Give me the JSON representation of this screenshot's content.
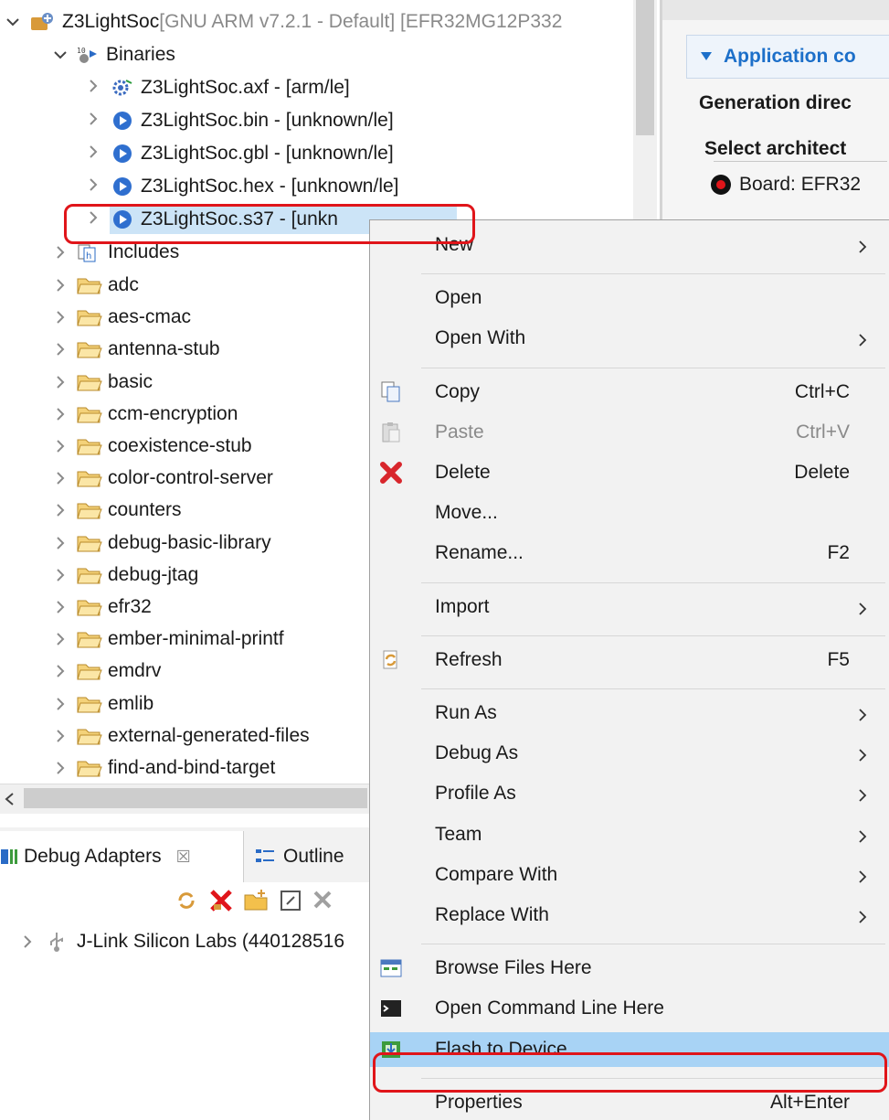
{
  "project": {
    "name": "Z3LightSoc",
    "suffix": " [GNU ARM v7.2.1 - Default] [EFR32MG12P332",
    "binaries_label": "Binaries",
    "binaries": [
      {
        "label": "Z3LightSoc.axf - [arm/le]",
        "icon": "executable-gear-icon"
      },
      {
        "label": "Z3LightSoc.bin - [unknown/le]",
        "icon": "binary-file-icon"
      },
      {
        "label": "Z3LightSoc.gbl - [unknown/le]",
        "icon": "binary-file-icon"
      },
      {
        "label": "Z3LightSoc.hex - [unknown/le]",
        "icon": "binary-file-icon"
      },
      {
        "label": "Z3LightSoc.s37 - [unkn",
        "icon": "binary-file-icon",
        "selected": true
      }
    ],
    "includes_label": "Includes",
    "folders": [
      "adc",
      "aes-cmac",
      "antenna-stub",
      "basic",
      "ccm-encryption",
      "coexistence-stub",
      "color-control-server",
      "counters",
      "debug-basic-library",
      "debug-jtag",
      "efr32",
      "ember-minimal-printf",
      "emdrv",
      "emlib",
      "external-generated-files",
      "find-and-bind-target"
    ]
  },
  "right_panel": {
    "section_title": "Application co",
    "generation_label": "Generation direc",
    "arch_label": "Select architect",
    "board_label": "Board: EFR32"
  },
  "debug_panel": {
    "tabs": [
      {
        "label": "Debug Adapters",
        "close": "☒"
      },
      {
        "label": "Outline"
      }
    ],
    "adapter": "J-Link Silicon Labs (440128516"
  },
  "context_menu": {
    "items": [
      {
        "label": "New",
        "submenu": true
      },
      {
        "separator": true
      },
      {
        "label": "Open"
      },
      {
        "label": "Open With",
        "submenu": true
      },
      {
        "separator": true
      },
      {
        "label": "Copy",
        "shortcut": "Ctrl+C",
        "icon": "copy-icon"
      },
      {
        "label": "Paste",
        "shortcut": "Ctrl+V",
        "icon": "paste-icon",
        "disabled": true
      },
      {
        "label": "Delete",
        "shortcut": "Delete",
        "icon": "delete-icon"
      },
      {
        "label": "Move..."
      },
      {
        "label": "Rename...",
        "shortcut": "F2"
      },
      {
        "separator": true
      },
      {
        "label": "Import",
        "submenu": true
      },
      {
        "separator": true
      },
      {
        "label": "Refresh",
        "shortcut": "F5",
        "icon": "refresh-icon"
      },
      {
        "separator": true
      },
      {
        "label": "Run As",
        "submenu": true
      },
      {
        "label": "Debug As",
        "submenu": true
      },
      {
        "label": "Profile As",
        "submenu": true
      },
      {
        "label": "Team",
        "submenu": true
      },
      {
        "label": "Compare With",
        "submenu": true
      },
      {
        "label": "Replace With",
        "submenu": true
      },
      {
        "separator": true
      },
      {
        "label": "Browse Files Here",
        "icon": "browse-files-icon"
      },
      {
        "label": "Open Command Line Here",
        "icon": "terminal-icon"
      },
      {
        "label": "Flash to Device...",
        "icon": "flash-device-icon",
        "highlighted": true
      },
      {
        "separator": true
      },
      {
        "label": "Properties",
        "shortcut": "Alt+Enter"
      }
    ]
  },
  "colors": {
    "highlight": "#a8d3f5",
    "annotation": "#e0151a",
    "accent": "#1c6fc9"
  }
}
